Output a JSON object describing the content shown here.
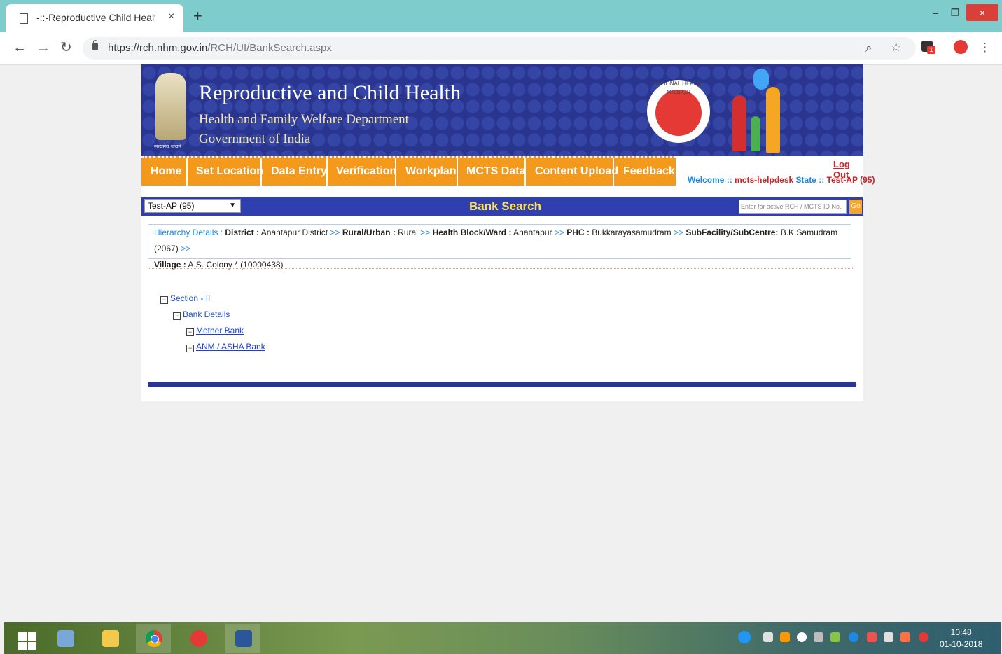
{
  "browser": {
    "tab_title": "-::-Reproductive Child Health (Rc",
    "tab_close": "×",
    "new_tab": "+",
    "url_host": "https://rch.nhm.gov.in",
    "url_path": "/RCH/UI/BankSearch.aspx",
    "ext_badge": "1",
    "win_min": "‒",
    "win_max": "❐",
    "win_close": "×",
    "icons": [
      "back-arrow-icon",
      "forward-arrow-icon",
      "reload-icon",
      "lock-icon",
      "zoom-icon",
      "star-icon",
      "extension-icon",
      "profile-icon",
      "menu-dots-icon"
    ]
  },
  "banner": {
    "title": "Reproductive and Child Health",
    "subtitle1": "Health and Family Welfare Department",
    "subtitle2": "Government of India",
    "emblem_caption": "सत्यमेव जयते",
    "nhm_ring": "NATIONAL HEALTH MISSION"
  },
  "menu": {
    "items": [
      "Home",
      "Set Location",
      "Data Entry",
      "Verification",
      "Workplan",
      "MCTS Data",
      "Content Upload",
      "Feedback"
    ]
  },
  "user": {
    "logout": "Log Out",
    "welcome_label": "Welcome ::",
    "username": "mcts-helpdesk",
    "state_label": "State ::",
    "state_value": "Test-AP (95)"
  },
  "search": {
    "state_selected": "Test-AP (95)",
    "page_title": "Bank Search",
    "input_placeholder": "Enter for active RCH / MCTS ID No.",
    "go_label": "Go"
  },
  "hierarchy": {
    "label": "Hierarchy Details :",
    "district_label": "District :",
    "district": "Anantapur District",
    "sep": ">>",
    "rural_label": "Rural/Urban :",
    "rural": "Rural",
    "block_label": "Health Block/Ward :",
    "block": "Anantapur",
    "phc_label": "PHC :",
    "phc": "Bukkarayasamudram",
    "subfac_label": "SubFacility/SubCentre:",
    "subfac": "B.K.Samudram (2067)",
    "village_label": "Village :",
    "village": "A.S. Colony * (10000438)"
  },
  "tree": {
    "box": "−",
    "section": "Section - II",
    "bank_details": "Bank Details",
    "mother_bank": "Mother Bank",
    "anm_bank": "ANM / ASHA Bank"
  },
  "taskbar": {
    "time": "10:48",
    "date": "01-10-2018",
    "apps": [
      "windows-start-icon",
      "network-app-icon",
      "file-explorer-icon",
      "chrome-icon",
      "mail-icon",
      "word-icon"
    ]
  },
  "colors": {
    "banner_bg": "#2a3590",
    "menu_bg": "#f39a1d",
    "search_bar": "#2f3fb0",
    "bank_title": "#ffe14d",
    "link_blue": "#1e88e5",
    "accent_red": "#c62828"
  }
}
